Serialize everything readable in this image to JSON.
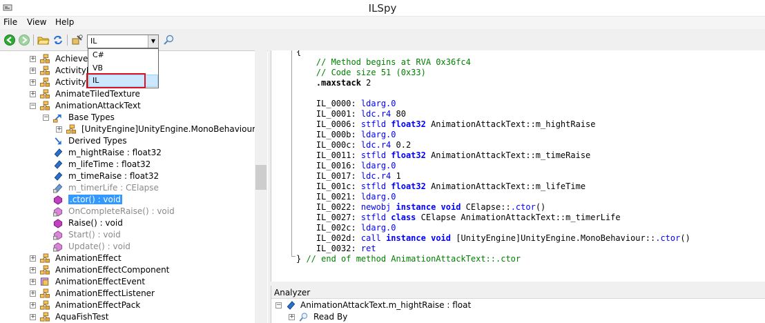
{
  "window": {
    "title": "ILSpy"
  },
  "menu": [
    "File",
    "View",
    "Help"
  ],
  "toolbar": {
    "language_value": "IL",
    "language_options": [
      "C#",
      "VB",
      "IL"
    ],
    "icons": [
      "back-icon",
      "forward-icon",
      "open-icon",
      "refresh-icon",
      "search-assembly-icon",
      "search-icon"
    ]
  },
  "tree": [
    {
      "label": "AchieveS",
      "indent": 0,
      "expander": "+",
      "icon": "class",
      "style": "normal"
    },
    {
      "label": "ActivityD",
      "indent": 0,
      "expander": "+",
      "icon": "class",
      "style": "normal"
    },
    {
      "label": "Activity",
      "indent": 0,
      "expander": "+",
      "icon": "class",
      "style": "normal"
    },
    {
      "label": "AnimateTiledTexture",
      "indent": 0,
      "expander": "+",
      "icon": "class",
      "style": "normal"
    },
    {
      "label": "AnimationAttackText",
      "indent": 0,
      "expander": "-",
      "icon": "class",
      "style": "normal"
    },
    {
      "label": "Base Types",
      "indent": 1,
      "expander": "-",
      "icon": "base-types",
      "style": "normal"
    },
    {
      "label": "[UnityEngine]UnityEngine.MonoBehaviour",
      "indent": 2,
      "expander": "+",
      "icon": "class",
      "style": "normal"
    },
    {
      "label": "Derived Types",
      "indent": 1,
      "expander": "",
      "icon": "derived-types",
      "style": "normal"
    },
    {
      "label": "m_hightRaise : float32",
      "indent": 1,
      "expander": "",
      "icon": "field",
      "style": "normal"
    },
    {
      "label": "m_lifeTime : float32",
      "indent": 1,
      "expander": "",
      "icon": "field",
      "style": "normal"
    },
    {
      "label": "m_timeRaise : float32",
      "indent": 1,
      "expander": "",
      "icon": "field",
      "style": "normal"
    },
    {
      "label": "m_timerLife : CElapse",
      "indent": 1,
      "expander": "",
      "icon": "field-private",
      "style": "gray"
    },
    {
      "label": ".ctor() : void",
      "indent": 1,
      "expander": "",
      "icon": "method",
      "style": "selected"
    },
    {
      "label": "OnCompleteRaise() : void",
      "indent": 1,
      "expander": "",
      "icon": "method-private",
      "style": "gray"
    },
    {
      "label": "Raise() : void",
      "indent": 1,
      "expander": "",
      "icon": "method",
      "style": "normal"
    },
    {
      "label": "Start() : void",
      "indent": 1,
      "expander": "",
      "icon": "method-private",
      "style": "gray"
    },
    {
      "label": "Update() : void",
      "indent": 1,
      "expander": "",
      "icon": "method-private",
      "style": "gray"
    },
    {
      "label": "AnimationEffect",
      "indent": 0,
      "expander": "+",
      "icon": "class",
      "style": "normal"
    },
    {
      "label": "AnimationEffectComponent",
      "indent": 0,
      "expander": "+",
      "icon": "class",
      "style": "normal"
    },
    {
      "label": "AnimationEffectEvent",
      "indent": 0,
      "expander": "+",
      "icon": "enum",
      "style": "normal"
    },
    {
      "label": "AnimationEffectListener",
      "indent": 0,
      "expander": "+",
      "icon": "class",
      "style": "normal"
    },
    {
      "label": "AnimationEffectPack",
      "indent": 0,
      "expander": "+",
      "icon": "class",
      "style": "normal"
    },
    {
      "label": "AquaFishTest",
      "indent": 0,
      "expander": "+",
      "icon": "class",
      "style": "normal"
    }
  ],
  "code": [
    [
      [
        "{",
        "bk"
      ]
    ],
    [
      [
        "    // Method begins at RVA 0x36fc4",
        "cm"
      ]
    ],
    [
      [
        "    // Code size 51 (0x33)",
        "cm"
      ]
    ],
    [
      [
        "    .maxstack",
        "bold"
      ],
      [
        " 2",
        "bk"
      ]
    ],
    [
      [
        "",
        "bk"
      ]
    ],
    [
      [
        "    IL_0000: ",
        "bk"
      ],
      [
        "ldarg.0",
        "kw"
      ]
    ],
    [
      [
        "    IL_0001: ",
        "bk"
      ],
      [
        "ldc.r4",
        "kw"
      ],
      [
        " 80",
        "bk"
      ]
    ],
    [
      [
        "    IL_0006: ",
        "bk"
      ],
      [
        "stfld",
        "kw"
      ],
      [
        " ",
        "bk"
      ],
      [
        "float32",
        "kw bold"
      ],
      [
        " AnimationAttackText::m_hightRaise",
        "bk"
      ]
    ],
    [
      [
        "    IL_000b: ",
        "bk"
      ],
      [
        "ldarg.0",
        "kw"
      ]
    ],
    [
      [
        "    IL_000c: ",
        "bk"
      ],
      [
        "ldc.r4",
        "kw"
      ],
      [
        " 0.2",
        "bk"
      ]
    ],
    [
      [
        "    IL_0011: ",
        "bk"
      ],
      [
        "stfld",
        "kw"
      ],
      [
        " ",
        "bk"
      ],
      [
        "float32",
        "kw bold"
      ],
      [
        " AnimationAttackText::m_timeRaise",
        "bk"
      ]
    ],
    [
      [
        "    IL_0016: ",
        "bk"
      ],
      [
        "ldarg.0",
        "kw"
      ]
    ],
    [
      [
        "    IL_0017: ",
        "bk"
      ],
      [
        "ldc.r4",
        "kw"
      ],
      [
        " 1",
        "bk"
      ]
    ],
    [
      [
        "    IL_001c: ",
        "bk"
      ],
      [
        "stfld",
        "kw"
      ],
      [
        " ",
        "bk"
      ],
      [
        "float32",
        "kw bold"
      ],
      [
        " AnimationAttackText::m_lifeTime",
        "bk"
      ]
    ],
    [
      [
        "    IL_0021: ",
        "bk"
      ],
      [
        "ldarg.0",
        "kw"
      ]
    ],
    [
      [
        "    IL_0022: ",
        "bk"
      ],
      [
        "newobj",
        "kw"
      ],
      [
        " ",
        "bk"
      ],
      [
        "instance",
        "kw bold"
      ],
      [
        " ",
        "bk"
      ],
      [
        "void",
        "kw bold"
      ],
      [
        " CElapse::",
        "bk"
      ],
      [
        ".ctor",
        "kw"
      ],
      [
        "()",
        "bk"
      ]
    ],
    [
      [
        "    IL_0027: ",
        "bk"
      ],
      [
        "stfld",
        "kw"
      ],
      [
        " ",
        "bk"
      ],
      [
        "class",
        "kw bold"
      ],
      [
        " CElapse AnimationAttackText::m_timerLife",
        "bk"
      ]
    ],
    [
      [
        "    IL_002c: ",
        "bk"
      ],
      [
        "ldarg.0",
        "kw"
      ]
    ],
    [
      [
        "    IL_002d: ",
        "bk"
      ],
      [
        "call",
        "kw"
      ],
      [
        " ",
        "bk"
      ],
      [
        "instance",
        "kw bold"
      ],
      [
        " ",
        "bk"
      ],
      [
        "void",
        "kw bold"
      ],
      [
        " [UnityEngine]UnityEngine.MonoBehaviour::",
        "bk"
      ],
      [
        ".ctor",
        "kw"
      ],
      [
        "()",
        "bk"
      ]
    ],
    [
      [
        "    IL_0032: ",
        "bk"
      ],
      [
        "ret",
        "kw"
      ]
    ],
    [
      [
        "} ",
        "bk"
      ],
      [
        "// end of method AnimationAttackText::.ctor",
        "cm"
      ]
    ]
  ],
  "analyzer": {
    "title": "Analyzer",
    "items": [
      {
        "label": "AnimationAttackText.m_hightRaise : float",
        "indent": 0,
        "expander": "-",
        "icon": "field"
      },
      {
        "label": "Read By",
        "indent": 1,
        "expander": "+",
        "icon": "search"
      }
    ]
  }
}
